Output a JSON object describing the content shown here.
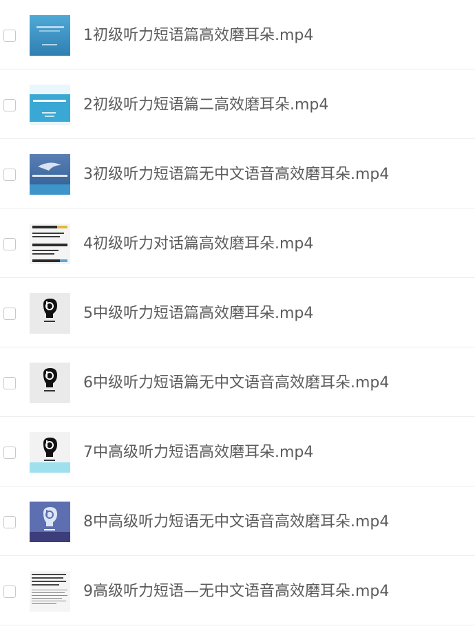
{
  "files": [
    {
      "name": "1初级听力短语篇高效磨耳朵.mp4",
      "thumb": "ocean-blue"
    },
    {
      "name": "2初级听力短语篇二高效磨耳朵.mp4",
      "thumb": "sky-cyan"
    },
    {
      "name": "3初级听力短语篇无中文语音高效磨耳朵.mp4",
      "thumb": "dolphin-blue"
    },
    {
      "name": "4初级听力对话篇高效磨耳朵.mp4",
      "thumb": "text-slides"
    },
    {
      "name": "5中级听力短语篇高效磨耳朵.mp4",
      "thumb": "lingo-logo-gray"
    },
    {
      "name": "6中级听力短语篇无中文语音高效磨耳朵.mp4",
      "thumb": "lingo-logo-gray"
    },
    {
      "name": "7中高级听力短语高效磨耳朵.mp4",
      "thumb": "lingo-logo-cyan"
    },
    {
      "name": "8中高级听力短语无中文语音高效磨耳朵.mp4",
      "thumb": "lingo-logo-purple"
    },
    {
      "name": "9高级听力短语—无中文语音高效磨耳朵.mp4",
      "thumb": "text-document"
    }
  ]
}
